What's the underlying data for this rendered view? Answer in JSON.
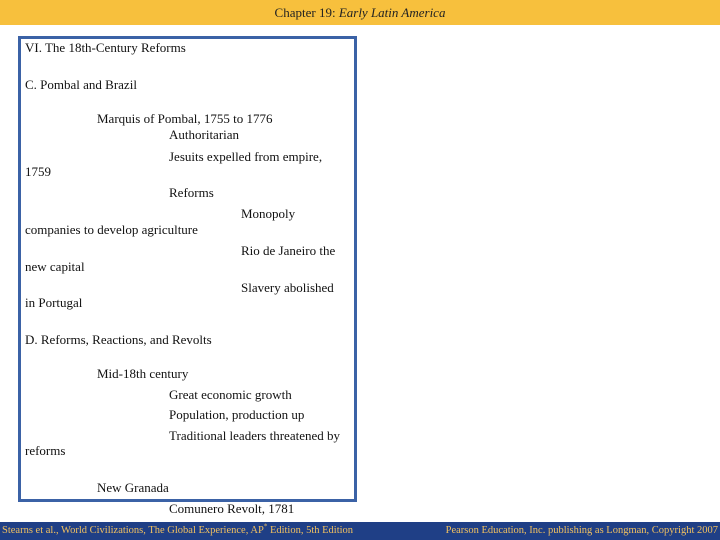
{
  "header": {
    "chapter": "Chapter 19: ",
    "title": "Early Latin America"
  },
  "outline": {
    "lines": [
      "VI. The 18th-Century Reforms",
      "C. Pombal and Brazil",
      "Marquis of Pombal, 1755 to 1776",
      "Authoritarian",
      "Jesuits expelled from empire,",
      "1759",
      "Reforms",
      "Monopoly",
      "companies to develop agriculture",
      "Rio de Janeiro the",
      "new capital",
      "Slavery abolished",
      "in Portugal",
      "D. Reforms, Reactions, and Revolts",
      "Mid-18th century",
      "Great economic growth",
      "Population, production up",
      "Traditional leaders threatened by",
      "reforms",
      "New Granada",
      "Comunero Revolt, 1781"
    ]
  },
  "footer": {
    "left_a": "Stearns et al., World Civilizations, The Global Experience, AP",
    "left_sup": "*",
    "left_b": " Edition, 5th Edition",
    "right": "Pearson Education, Inc. publishing as Longman, Copyright 2007"
  },
  "colors": {
    "header_bg": "#f7c03d",
    "box_border": "#3b62a6",
    "footer_bg": "#1f3f86",
    "footer_text": "#f0c060"
  }
}
